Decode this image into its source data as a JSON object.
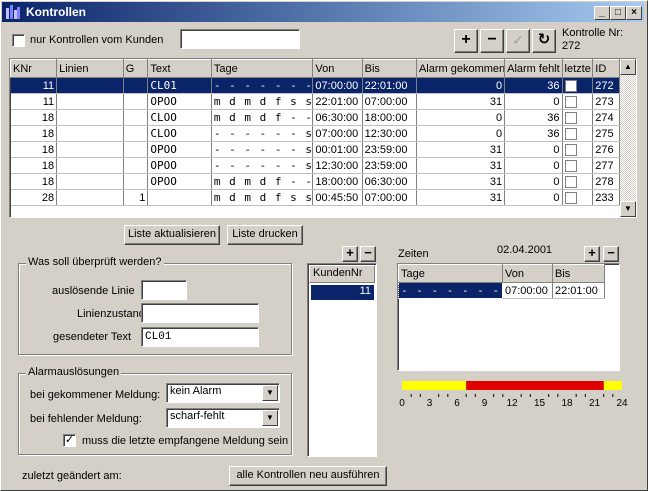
{
  "window": {
    "title": "Kontrollen"
  },
  "filter": {
    "checkbox_label": "nur Kontrollen vom Kunden",
    "customer_value": ""
  },
  "toolbar": {
    "add": "+",
    "remove": "−",
    "confirm": "✓",
    "refresh": "↻"
  },
  "kontrolle": {
    "label": "Kontrolle Nr:",
    "value": "272"
  },
  "grid": {
    "columns": [
      "KNr",
      "Linien",
      "G",
      "Text",
      "Tage",
      "Von",
      "Bis",
      "Alarm gekommen",
      "Alarm fehlt",
      "letzte",
      "ID"
    ],
    "rows": [
      {
        "knr": "11",
        "linien": "",
        "g": "",
        "text": "CL01",
        "tage": "- - - - - - -",
        "von": "07:00:00",
        "bis": "22:01:00",
        "gekommen": "0",
        "fehlt": "36",
        "letzte": false,
        "id": "272",
        "selected": true
      },
      {
        "knr": "11",
        "linien": "",
        "g": "",
        "text": "OPOO",
        "tage": "m d m d f s s",
        "von": "22:01:00",
        "bis": "07:00:00",
        "gekommen": "31",
        "fehlt": "0",
        "letzte": false,
        "id": "273"
      },
      {
        "knr": "18",
        "linien": "",
        "g": "",
        "text": "CLOO",
        "tage": "m d m d f - -",
        "von": "06:30:00",
        "bis": "18:00:00",
        "gekommen": "0",
        "fehlt": "36",
        "letzte": false,
        "id": "274"
      },
      {
        "knr": "18",
        "linien": "",
        "g": "",
        "text": "CLOO",
        "tage": "- - - - - - s",
        "von": "07:00:00",
        "bis": "12:30:00",
        "gekommen": "0",
        "fehlt": "36",
        "letzte": false,
        "id": "275"
      },
      {
        "knr": "18",
        "linien": "",
        "g": "",
        "text": "OPOO",
        "tage": "- - - - - - s",
        "von": "00:01:00",
        "bis": "23:59:00",
        "gekommen": "31",
        "fehlt": "0",
        "letzte": false,
        "id": "276"
      },
      {
        "knr": "18",
        "linien": "",
        "g": "",
        "text": "OPOO",
        "tage": "- - - - - - s",
        "von": "12:30:00",
        "bis": "23:59:00",
        "gekommen": "31",
        "fehlt": "0",
        "letzte": false,
        "id": "277"
      },
      {
        "knr": "18",
        "linien": "",
        "g": "",
        "text": "OPOO",
        "tage": "m d m d f - -",
        "von": "18:00:00",
        "bis": "06:30:00",
        "gekommen": "31",
        "fehlt": "0",
        "letzte": false,
        "id": "278"
      },
      {
        "knr": "28",
        "linien": "",
        "g": "1",
        "text": "",
        "tage": "m d m d f s s",
        "von": "00:45:50",
        "bis": "07:00:00",
        "gekommen": "31",
        "fehlt": "0",
        "letzte": false,
        "id": "233"
      }
    ]
  },
  "buttons": {
    "refresh_list": "Liste aktualisieren",
    "print_list": "Liste drucken",
    "run_all": "alle Kontrollen neu ausführen"
  },
  "check_group": {
    "title": "Was soll überprüft werden?",
    "trigger_line_label": "auslösende Linie",
    "trigger_line_value": "",
    "line_state_label": "Linienzustand",
    "line_state_value": "",
    "sent_text_label": "gesendeter Text",
    "sent_text_value": "CL01"
  },
  "alarm_group": {
    "title": "Alarmauslösungen",
    "received_label": "bei gekommener Meldung:",
    "received_value": "kein Alarm",
    "missing_label": "bei fehlender Meldung:",
    "missing_value": "scharf-fehlt",
    "last_checkbox_label": "muss die letzte empfangene Meldung sein",
    "last_checked": true
  },
  "customers": {
    "add": "+",
    "remove": "−",
    "header": "KundenNr",
    "rows": [
      "11"
    ]
  },
  "times": {
    "title": "Zeiten",
    "date": "02.04.2001",
    "add": "+",
    "remove": "−",
    "columns": [
      "Tage",
      "Von",
      "Bis"
    ],
    "rows": [
      {
        "tage": "- - - - - - -",
        "von": "07:00:00",
        "bis": "22:01:00"
      }
    ]
  },
  "timeline": {
    "labels": [
      "0",
      "3",
      "6",
      "9",
      "12",
      "15",
      "18",
      "21",
      "24"
    ],
    "active_from_h": 7.0,
    "active_to_h": 22.02,
    "active_color": "#e00000",
    "inactive_color": "#ffff00"
  },
  "footer": {
    "changed_label": "zuletzt geändert am:",
    "changed_value": ""
  }
}
